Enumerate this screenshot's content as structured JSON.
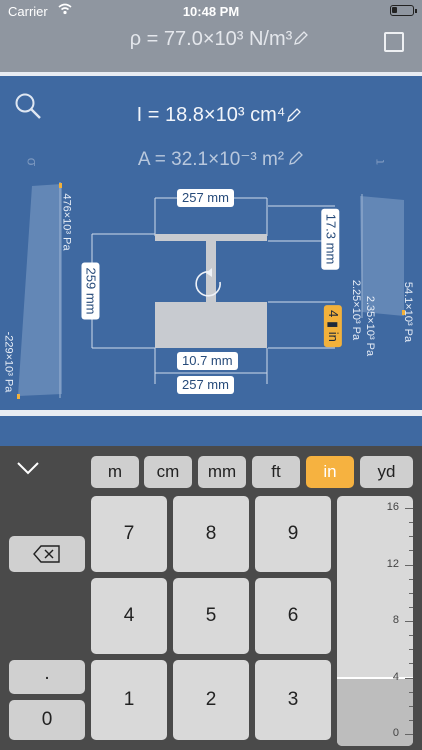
{
  "status": {
    "carrier": "Carrier",
    "time": "10:48 PM"
  },
  "header": {
    "density": "ρ = 77.0×10³ N/m³"
  },
  "section": {
    "moment_of_inertia": "I = 18.8×10³ cm⁴",
    "area": "A = 32.1×10⁻³ m²",
    "top_stress": "476×10³ Pa",
    "bottom_stress": "-229×10³ Pa",
    "right_stress_top": "54.1×10³ Pa",
    "right_stress_mid1": "2.35×10³ Pa",
    "right_stress_mid2": "2.25×10³ Pa",
    "top_flange_width": "257 mm",
    "flange_thickness": "17.3 mm",
    "web_height": "259 mm",
    "web_thickness": "10.7 mm",
    "bottom_flange_width": "257 mm",
    "editing_value": "4",
    "editing_unit": "in",
    "sigma_left": "σ",
    "sigma_right": "τ"
  },
  "keyboard": {
    "units": [
      "m",
      "cm",
      "mm",
      "ft",
      "in",
      "yd"
    ],
    "active_unit": "in",
    "keys": [
      "7",
      "8",
      "9",
      "4",
      "5",
      "6",
      "1",
      "2",
      "3"
    ],
    "dot": ".",
    "zero": "0",
    "slider": {
      "ticks": [
        "16",
        "12",
        "8",
        "4",
        "0"
      ],
      "value": 4,
      "max": 16
    }
  },
  "icons": [
    "wifi-icon",
    "battery-icon",
    "pencil-icon",
    "checkbox-icon",
    "search-icon",
    "rotate-icon",
    "chevron-down-icon",
    "backspace-icon"
  ],
  "colors": {
    "accent": "#f6b240",
    "panel": "#3f69a1",
    "keyboard": "#4a4a4a"
  }
}
